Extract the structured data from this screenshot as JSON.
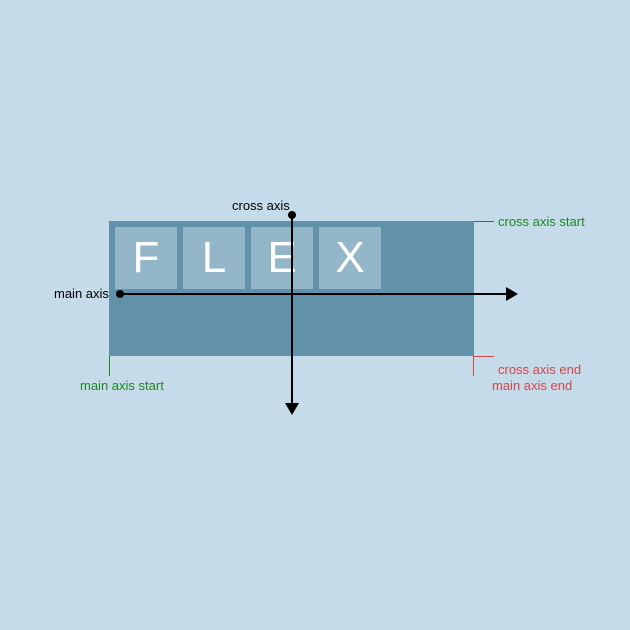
{
  "container": {
    "color": "#6291aa",
    "item_color": "#93b6c8",
    "items": [
      "F",
      "L",
      "E",
      "X"
    ]
  },
  "labels": {
    "cross_axis": "cross axis",
    "main_axis": "main axis",
    "cross_axis_start": "cross axis start",
    "cross_axis_end": "cross axis end",
    "main_axis_start": "main axis start",
    "main_axis_end": "main axis end"
  },
  "colors": {
    "start": "#1a8a1a",
    "end": "#d64545",
    "axis": "#000000",
    "background": "#c5dbea"
  }
}
